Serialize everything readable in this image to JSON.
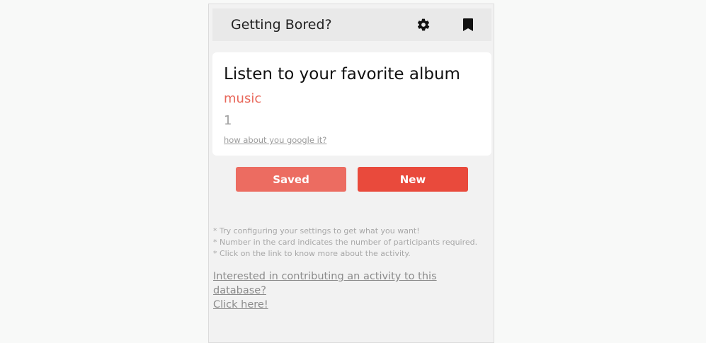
{
  "header": {
    "title": "Getting Bored?",
    "icons": [
      "gear-icon",
      "bookmark-icon"
    ]
  },
  "card": {
    "activity": "Listen to your favorite album",
    "type": "music",
    "participants": "1",
    "link_text": "how about you google it?"
  },
  "buttons": {
    "saved_label": "Saved",
    "new_label": "New"
  },
  "notes": [
    "* Try configuring your settings to get what you want!",
    "* Number in the card indicates the number of participants required.",
    "* Click on the link to know more about the activity."
  ],
  "contribute": {
    "line1": "Interested in contributing an activity to this database?",
    "line2": "Click here!"
  },
  "colors": {
    "accent_red": "#e94a3c",
    "saved_button": "#ec6c61",
    "type_text": "#e8675a",
    "background": "#f2f2f2"
  }
}
